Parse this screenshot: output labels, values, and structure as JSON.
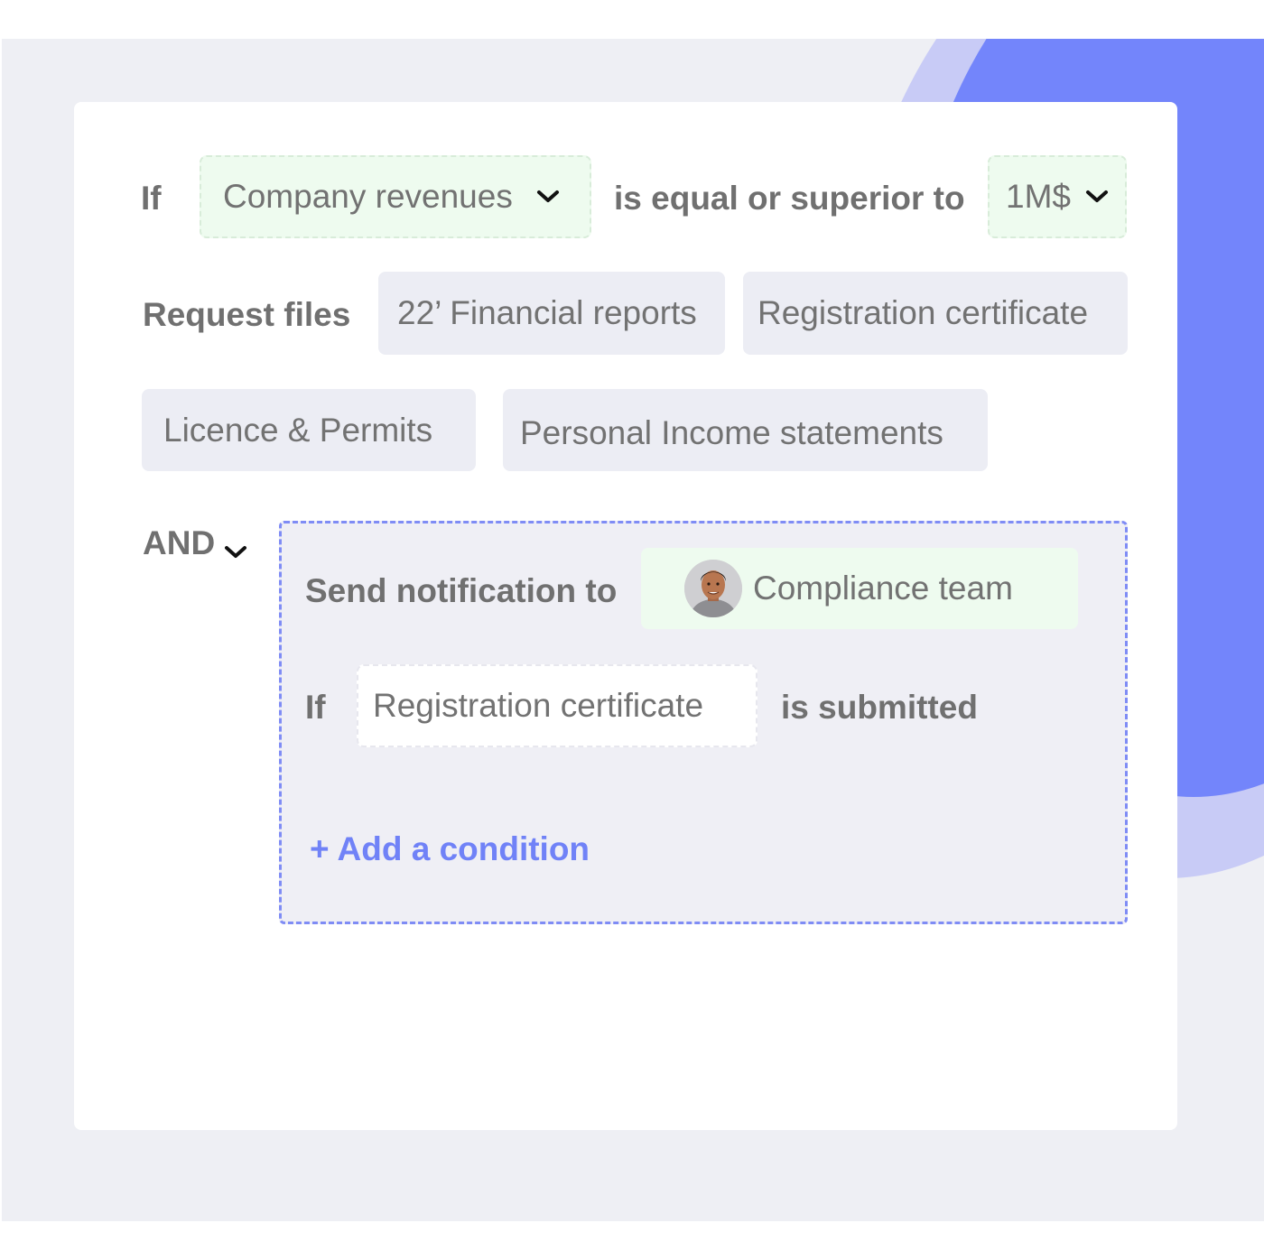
{
  "rule": {
    "if_label": "If",
    "field_value": "Company revenues",
    "operator": "is equal or superior to",
    "threshold_value": "1M$"
  },
  "request": {
    "label": "Request files",
    "files": [
      "22’ Financial reports",
      "Registration certificate",
      "Licence & Permits",
      "Personal Income statements"
    ]
  },
  "connector": {
    "label": "AND"
  },
  "notification": {
    "label": "Send notification to",
    "recipient": "Compliance team",
    "avatar_icon": "person-avatar"
  },
  "sub_condition": {
    "if_label": "If",
    "document": "Registration certificate",
    "status": "is submitted"
  },
  "add_condition_label": "+ Add a condition",
  "colors": {
    "accent": "#7385fb",
    "link": "#7082f7",
    "chip_green": "#eefbef",
    "chip_grey": "#ecedf4",
    "backdrop": "#eeeff4"
  }
}
